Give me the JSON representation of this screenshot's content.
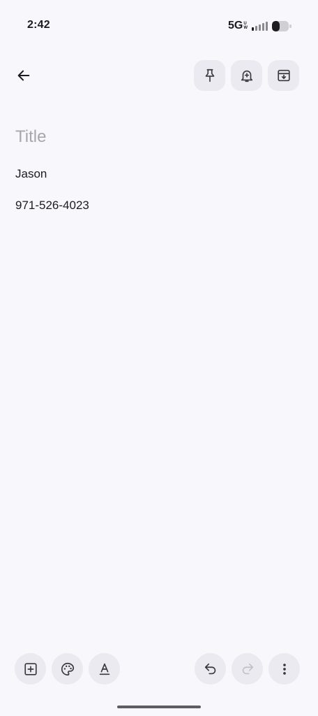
{
  "status": {
    "time": "2:42",
    "network": "5G",
    "network_sub_top": "U",
    "network_sub_bottom": "W",
    "battery_level": 0.45
  },
  "toolbar": {
    "back_icon": "arrow-left-icon",
    "actions": [
      {
        "name": "pin",
        "icon": "pin-icon"
      },
      {
        "name": "reminder",
        "icon": "bell-plus-icon"
      },
      {
        "name": "archive",
        "icon": "archive-icon"
      }
    ]
  },
  "note": {
    "title_value": "",
    "title_placeholder": "Title",
    "lines": [
      "Jason",
      "971-526-4023"
    ]
  },
  "bottom_bar": {
    "left": [
      {
        "name": "add",
        "icon": "add-box-icon"
      },
      {
        "name": "background",
        "icon": "palette-icon"
      },
      {
        "name": "formatting",
        "icon": "text-format-icon"
      }
    ],
    "right": [
      {
        "name": "undo",
        "icon": "undo-icon",
        "enabled": true
      },
      {
        "name": "redo",
        "icon": "redo-icon",
        "enabled": false
      },
      {
        "name": "more",
        "icon": "more-vert-icon"
      }
    ]
  },
  "colors": {
    "background": "#f8f7fc",
    "button_bg": "#eceaf1",
    "icon": "#3a383f",
    "disabled_icon": "#c3c1c8",
    "placeholder": "#a8a6ad"
  }
}
